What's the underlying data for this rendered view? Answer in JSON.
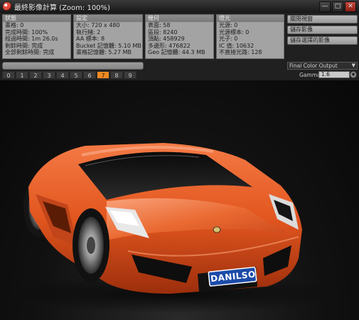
{
  "window": {
    "title": "最終影像計算 (Zoom: 100%)",
    "minimize_glyph": "—",
    "maximize_glyph": "□",
    "close_glyph": "✕"
  },
  "panels": {
    "status": {
      "title": "狀態",
      "lines": [
        "畫格: 0",
        "完成時間: 100%",
        "經過時間: 1m 26.0s",
        "剩餘時間: 完成",
        "全部剩餘時間: 完成"
      ]
    },
    "settings": {
      "title": "設定",
      "lines": [
        "大小: 720 x 480",
        "執行緒: 2",
        "AA 標本: 8",
        "Bucket 記憶體: 5.10 MB",
        "畫格記憶體: 5.27 MB"
      ]
    },
    "geometry": {
      "title": "幾何",
      "lines": [
        "表面: 58",
        "區段: 8240",
        "頂點: 458929",
        "多邊形: 476822",
        "Geo 記憶體: 44.3 MB"
      ]
    },
    "lights": {
      "title": "燈光",
      "lines": [
        "光源: 0",
        "光源標本: 0",
        "光子: 0",
        "IC 值: 10632",
        "不直接光路: 128"
      ]
    }
  },
  "buffers": [
    "0",
    "1",
    "2",
    "3",
    "4",
    "5",
    "6",
    "7",
    "8",
    "9"
  ],
  "active_buffer": "7",
  "actions": {
    "close": "關閉視窗",
    "save_image": "儲存影像",
    "save_selected": "儲存選擇的影像"
  },
  "output_select": {
    "value": "Final Color Output"
  },
  "gamma": {
    "label": "Gamma",
    "value": "1.6"
  },
  "render": {
    "plate_text": "DANILSO"
  },
  "colors": {
    "accent": "#f08a22",
    "car_body": "#e2561f",
    "panel_bg": "#a3a3a3"
  },
  "icons": {
    "app": "render-app-icon",
    "spinner": "spin-icon",
    "dropdown": "chevron-down-icon"
  }
}
